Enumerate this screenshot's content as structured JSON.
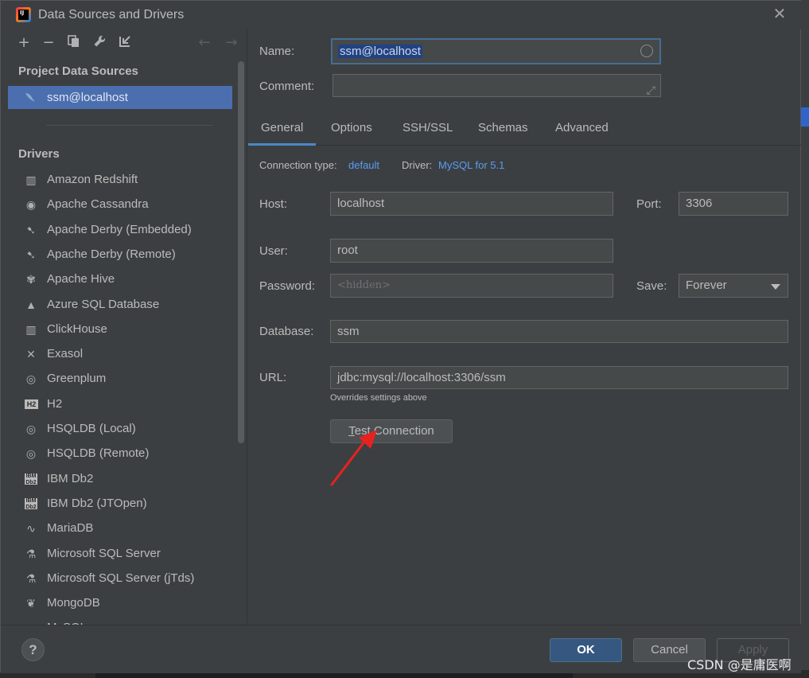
{
  "window": {
    "title": "Data Sources and Drivers",
    "app_icon_text": "IJ"
  },
  "toolbar": {
    "add": "+",
    "remove": "−",
    "copy": "⧉",
    "settings": "🔧",
    "import": "⇲",
    "back": "←",
    "forward": "→"
  },
  "left": {
    "project_title": "Project Data Sources",
    "project_items": [
      {
        "label": "ssm@localhost"
      }
    ],
    "drivers_title": "Drivers",
    "drivers": [
      {
        "label": "Amazon Redshift",
        "icon": "redshift-icon"
      },
      {
        "label": "Apache Cassandra",
        "icon": "cassandra-icon"
      },
      {
        "label": "Apache Derby (Embedded)",
        "icon": "derby-icon"
      },
      {
        "label": "Apache Derby (Remote)",
        "icon": "derby-icon"
      },
      {
        "label": "Apache Hive",
        "icon": "hive-icon"
      },
      {
        "label": "Azure SQL Database",
        "icon": "azure-icon"
      },
      {
        "label": "ClickHouse",
        "icon": "clickhouse-icon"
      },
      {
        "label": "Exasol",
        "icon": "exasol-icon"
      },
      {
        "label": "Greenplum",
        "icon": "greenplum-icon"
      },
      {
        "label": "H2",
        "icon": "h2-icon"
      },
      {
        "label": "HSQLDB (Local)",
        "icon": "hsqldb-icon"
      },
      {
        "label": "HSQLDB (Remote)",
        "icon": "hsqldb-icon"
      },
      {
        "label": "IBM Db2",
        "icon": "ibm-db2-icon"
      },
      {
        "label": "IBM Db2 (JTOpen)",
        "icon": "ibm-db2-icon"
      },
      {
        "label": "MariaDB",
        "icon": "mariadb-icon"
      },
      {
        "label": "Microsoft SQL Server",
        "icon": "mssql-icon"
      },
      {
        "label": "Microsoft SQL Server (jTds)",
        "icon": "mssql-icon"
      },
      {
        "label": "MongoDB",
        "icon": "mongodb-icon"
      },
      {
        "label": "MySQL",
        "icon": "mysql-icon"
      }
    ]
  },
  "form": {
    "name_label": "Name:",
    "name_value": "ssm@localhost",
    "comment_label": "Comment:",
    "comment_value": "",
    "tabs": [
      "General",
      "Options",
      "SSH/SSL",
      "Schemas",
      "Advanced"
    ],
    "connection_type_label": "Connection type:",
    "connection_type_value": "default",
    "driver_label": "Driver:",
    "driver_value": "MySQL for 5.1",
    "host_label": "Host:",
    "host_value": "localhost",
    "port_label": "Port:",
    "port_value": "3306",
    "user_label": "User:",
    "user_value": "root",
    "password_label": "Password:",
    "password_placeholder": "<hidden>",
    "save_label": "Save:",
    "save_value": "Forever",
    "database_label": "Database:",
    "database_value": "ssm",
    "url_label": "URL:",
    "url_value": "jdbc:mysql://localhost:3306/ssm",
    "url_hint": "Overrides settings above",
    "test_connection_mnemonic": "T",
    "test_connection_rest": "est Connection"
  },
  "buttons": {
    "ok": "OK",
    "cancel": "Cancel",
    "apply": "Apply",
    "help": "?"
  },
  "watermark": "CSDN @是庸医啊",
  "colors": {
    "accent": "#4b6eaf",
    "link": "#589df6",
    "primary_button": "#365880",
    "annotation_arrow": "#e8221f"
  }
}
